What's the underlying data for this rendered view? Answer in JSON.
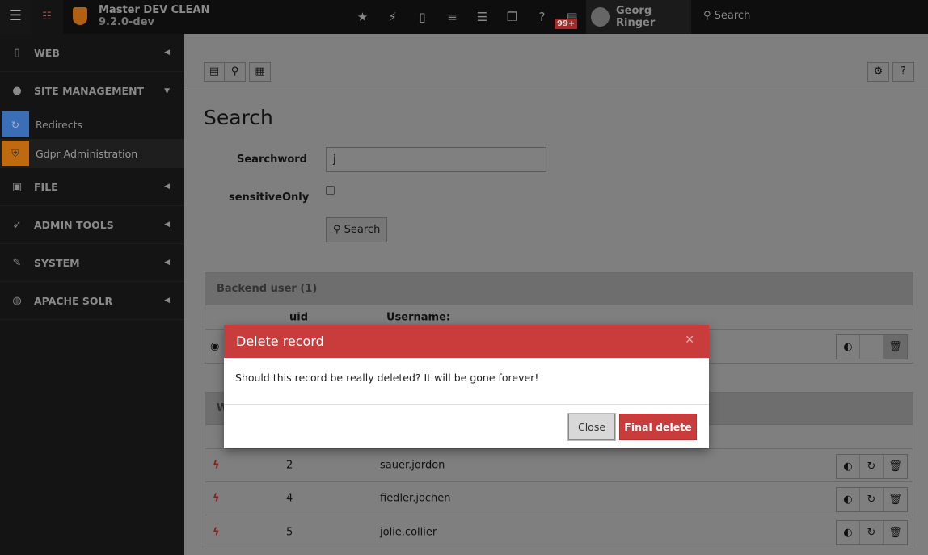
{
  "topbar": {
    "site_name": "Master DEV CLEAN",
    "version": "9.2.0-dev",
    "notification_badge": "99+",
    "user": "Georg Ringer",
    "search_label": "Search"
  },
  "sidebar": {
    "items": [
      {
        "label": "WEB",
        "icon": "page-icon"
      },
      {
        "label": "SITE MANAGEMENT",
        "icon": "globe-icon",
        "sub": [
          {
            "label": "Redirects",
            "color": "#3a6fb5"
          },
          {
            "label": "Gdpr Administration",
            "color": "#c06a10"
          }
        ]
      },
      {
        "label": "FILE",
        "icon": "image-icon"
      },
      {
        "label": "ADMIN TOOLS",
        "icon": "rocket-icon"
      },
      {
        "label": "SYSTEM",
        "icon": "plug-icon"
      },
      {
        "label": "APACHE SOLR",
        "icon": "solr-icon"
      }
    ]
  },
  "main": {
    "title": "Search",
    "searchword_label": "Searchword",
    "searchword_value": "j",
    "sensitive_label": "sensitiveOnly",
    "search_button": "Search",
    "panel1": {
      "title": "Backend user (1)",
      "col_uid": "uid",
      "col_username": "Username:"
    },
    "panel2": {
      "title": "W",
      "rows": [
        {
          "uid": "2",
          "username": "sauer.jordon"
        },
        {
          "uid": "4",
          "username": "fiedler.jochen"
        },
        {
          "uid": "5",
          "username": "jolie.collier"
        }
      ]
    }
  },
  "modal": {
    "title": "Delete record",
    "message": "Should this record be really deleted? It will be gone forever!",
    "close": "Close",
    "confirm": "Final delete",
    "header_color": "#c83c3c"
  }
}
